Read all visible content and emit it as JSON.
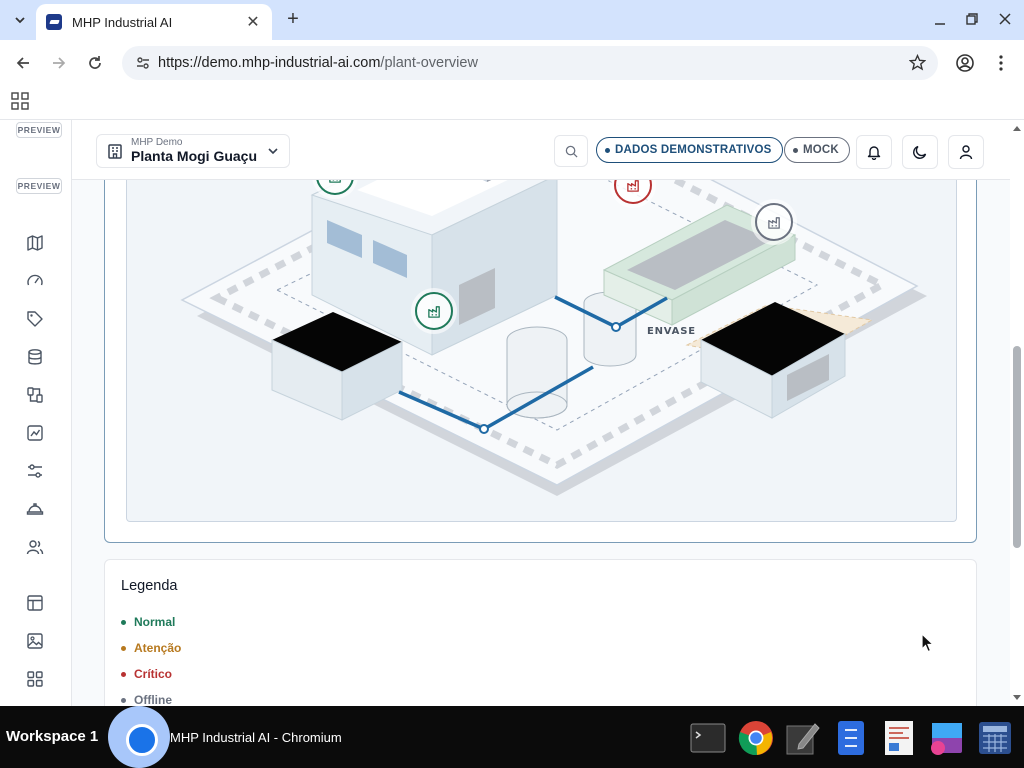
{
  "browser": {
    "tab_title": "MHP Industrial AI",
    "url_host": "https://demo.mhp-industrial-ai.com",
    "url_path": "/plant-overview"
  },
  "sidebar": {
    "preview_labels": [
      "PREVIEW",
      "PREVIEW"
    ],
    "icons": [
      "map-icon",
      "gauge-icon",
      "tag-icon",
      "database-icon",
      "flow-icon",
      "chart-icon",
      "sliders-icon",
      "helmet-icon",
      "users-icon",
      "layout-icon",
      "image-icon",
      "grid-icon"
    ]
  },
  "header": {
    "org": "MHP Demo",
    "plant": "Planta Mogi Guaçu",
    "demo_badge": "DADOS DEMONSTRATIVOS",
    "mock_badge": "MOCK"
  },
  "map": {
    "area_label": "ENVASE",
    "markers": [
      {
        "status": "Normal",
        "color": "#1f7a5a"
      },
      {
        "status": "Atenção",
        "color": "#b7791f"
      },
      {
        "status": "Crítico",
        "color": "#b83232"
      },
      {
        "status": "Offline",
        "color": "#6b7280"
      },
      {
        "status": "Normal",
        "color": "#1f7a5a"
      }
    ]
  },
  "legend": {
    "title": "Legenda",
    "items": [
      {
        "label": "Normal",
        "color": "#1f7a5a"
      },
      {
        "label": "Atenção",
        "color": "#b7791f"
      },
      {
        "label": "Crítico",
        "color": "#b83232"
      },
      {
        "label": "Offline",
        "color": "#6b7280"
      }
    ]
  },
  "taskbar": {
    "workspace": "Workspace 1",
    "window_title": "MHP Industrial AI - Chromium"
  },
  "colors": {
    "accent": "#1e3a8a",
    "pipe": "#1f6aa5"
  }
}
